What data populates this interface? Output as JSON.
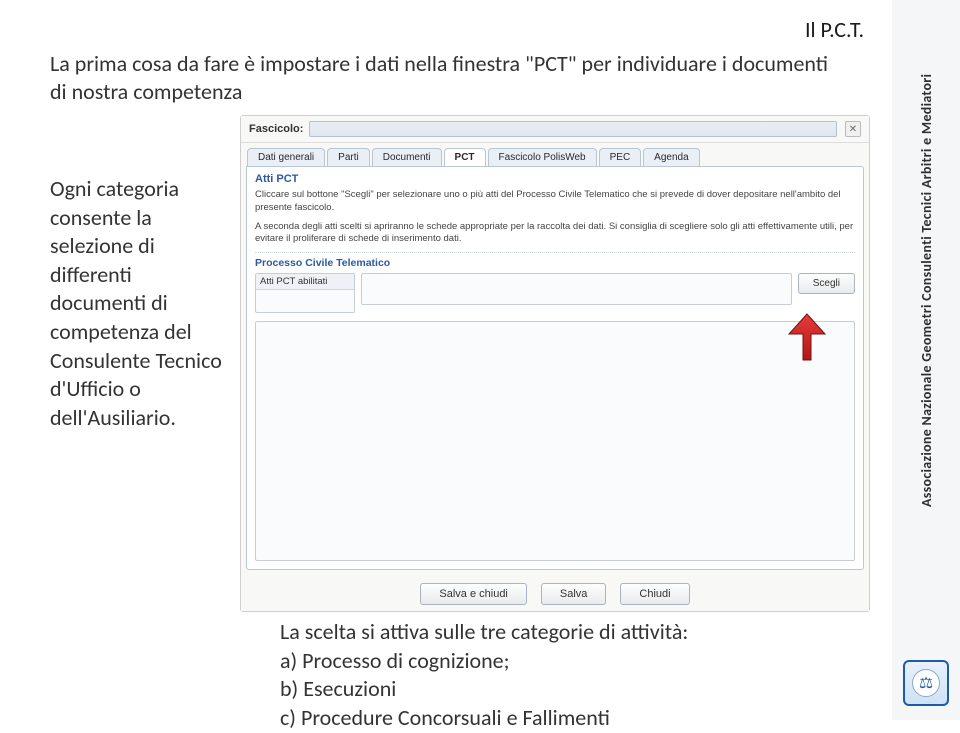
{
  "slide": {
    "header_label": "Il P.C.T.",
    "intro": "La prima cosa da fare è impostare i dati nella finestra \"PCT\" per individuare i documenti di nostra competenza",
    "left_para": "Ogni categoria consente la selezione di differenti documenti di competenza del Consulente Tecnico d'Ufficio o dell'Ausiliario.",
    "footer_l1": "La scelta si attiva sulle tre categorie di attività:",
    "footer_l2": "a) Processo di cognizione;",
    "footer_l3": "b) Esecuzioni",
    "footer_l4": "c) Procedure Concorsuali e Fallimenti"
  },
  "app": {
    "fascicolo_label": "Fascicolo:",
    "tabs": {
      "t0": "Dati generali",
      "t1": "Parti",
      "t2": "Documenti",
      "t3": "PCT",
      "t4": "Fascicolo PolisWeb",
      "t5": "PEC",
      "t6": "Agenda"
    },
    "group_atti": "Atti PCT",
    "hint1": "Cliccare sul bottone \"Scegli\" per selezionare uno o più atti del Processo Civile Telematico che si prevede di dover depositare nell'ambito del presente fascicolo.",
    "hint2": "A seconda degli atti scelti si apriranno le schede appropriate per la raccolta dei dati. Si consiglia di scegliere solo gli atti effettivamente utili, per evitare il proliferare di schede di inserimento dati.",
    "group_proc": "Processo Civile Telematico",
    "col_header": "Atti PCT abilitati",
    "scegli": "Scegli",
    "btn_save_close": "Salva e chiudi",
    "btn_save": "Salva",
    "btn_close": "Chiudi"
  },
  "sidebar": {
    "org": "Associazione Nazionale Geometri Consulenti Tecnici Arbitri e Mediatori"
  }
}
